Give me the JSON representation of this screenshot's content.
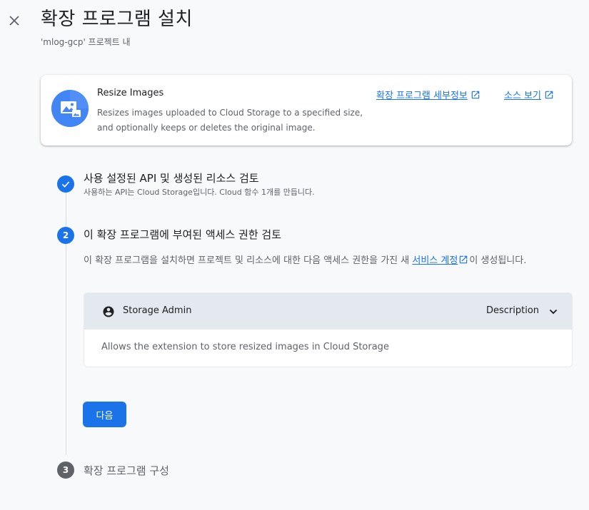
{
  "header": {
    "close_icon": "close-icon",
    "title": "확장 프로그램 설치",
    "subtitle": "'mlog-gcp' 프로젝트 내"
  },
  "extension": {
    "icon": "image-icon",
    "name": "Resize Images",
    "description": "Resizes images uploaded to Cloud Storage to a specified size, and optionally keeps or deletes the original image.",
    "details_link": "확장 프로그램 세부정보",
    "source_link": "소스 보기",
    "link_icon": "open-in-new-icon"
  },
  "steps": [
    {
      "number": "1",
      "icon": "check-icon",
      "title": "사용 설정된 API 및 생성된 리소스 검토",
      "subtitle": "사용하는 API는 Cloud Storage입니다. Cloud 함수 1개를 만듭니다."
    },
    {
      "number": "2",
      "title": "이 확장 프로그램에 부여된 액세스 권한 검토",
      "description_before": "이 확장 프로그램을 설치하면 프로젝트 및 리소스에 대한 다음 액세스 권한을 가진 새 ",
      "description_link": "서비스 계정",
      "description_after": "이 생성됩니다.",
      "permission": {
        "role_icon": "account-circle-icon",
        "role": "Storage Admin",
        "toggle_label": "Description",
        "toggle_icon": "chevron-down-icon",
        "body": "Allows the extension to store resized images in Cloud Storage"
      },
      "next_label": "다음"
    },
    {
      "number": "3",
      "title": "확장 프로그램 구성"
    }
  ],
  "colors": {
    "accent": "#1a73e8",
    "background": "#f8f9fa",
    "panel_header": "#e4e8ef",
    "inactive_step": "#5f6368"
  }
}
